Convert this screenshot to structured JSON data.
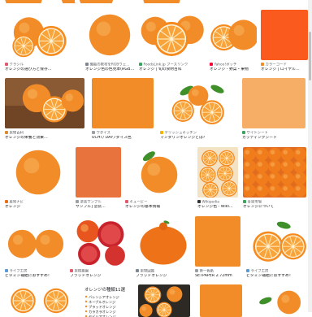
{
  "accent": {
    "orange": "#f28c28",
    "deep_orange": "#fb5a1e",
    "pale_orange": "#f6ad66"
  },
  "scrollbar": {
    "position": 0.12
  },
  "rows": [
    {
      "results": [
        {
          "art": "orange-slice-edge",
          "source": "",
          "favicon_color": "",
          "caption": ""
        },
        {
          "art": "orange-slice-edge",
          "source": "",
          "favicon_color": "",
          "caption": ""
        },
        {
          "art": "orange-slice-edge",
          "source": "",
          "favicon_color": "",
          "caption": ""
        },
        {
          "art": "orange-slice-edge",
          "source": "",
          "favicon_color": "",
          "caption": ""
        },
        {
          "art": "orange-slice-edge",
          "source": "",
          "favicon_color": "",
          "caption": ""
        }
      ]
    },
    {
      "results": [
        {
          "art": "orange-halves-white",
          "source": "クラシル",
          "favicon_color": "#e05a6d",
          "caption": "オレンジの選び方と保存…"
        },
        {
          "art": "orange-whole-single",
          "source": "機能の教材をRGBウェ…",
          "favicon_color": "#7b8794",
          "caption": "オレンジ色の色見本(RGB…"
        },
        {
          "art": "orange-group-slice",
          "source": "FoodsLink.jp フーズリンク",
          "favicon_color": "#3aa55d",
          "caption": "オレンジ | 旬の食材百科"
        },
        {
          "art": "orange-two-halves",
          "source": "Yahoo!ポッチ",
          "favicon_color": "#ff0033",
          "caption": "オレンジ - 野菜・果物"
        },
        {
          "art": "solid-deep-orange",
          "source": "カラーコード",
          "favicon_color": "#f28c28",
          "caption": "オレンジ | ロイヤル…"
        }
      ]
    },
    {
      "results": [
        {
          "art": "orange-on-wood",
          "source": "果物百科",
          "favicon_color": "#d88c2f",
          "caption": "オレンジの栄養と効果…"
        },
        {
          "art": "solid-orange",
          "source": "ワダイス",
          "favicon_color": "#9aa0a6",
          "caption": "UCHI / DAIワダイス色"
        },
        {
          "art": "orange-leaves",
          "source": "デリッシュキッチン",
          "favicon_color": "#f5b300",
          "caption": "マンダリンオレンジとは？"
        },
        {
          "art": "solid-orange-pale",
          "source": "サイトシート",
          "favicon_color": "#3aa55d",
          "caption": "カッティングシート"
        }
      ]
    },
    {
      "results": [
        {
          "art": "orange-whole-big",
          "source": "産地ナビ",
          "favicon_color": "#e7711b",
          "caption": "オレンジ"
        },
        {
          "art": "solid-orange-muted",
          "source": "塗装サンプル",
          "favicon_color": "#9aa0a6",
          "caption": "サンプル] 塗装…"
        },
        {
          "art": "orange-leaf-single",
          "source": "キューピー",
          "favicon_color": "#e05a6d",
          "caption": "オレンジの基本情報"
        },
        {
          "art": "orange-slices-grid",
          "source": "Wikipedia",
          "favicon_color": "#333333",
          "caption": "オレンジ色 - Wiki…"
        },
        {
          "art": "oranges-crate",
          "source": "青果市場",
          "favicon_color": "#3aa55d",
          "caption": "オレンジについて"
        }
      ]
    },
    {
      "results": [
        {
          "art": "orange-pair",
          "source": "ライフ工房",
          "favicon_color": "#5a9bd4",
          "caption": "ビタミン補給におすすめ！"
        },
        {
          "art": "blood-orange",
          "source": "果樹農園",
          "favicon_color": "#e05a6d",
          "caption": "ブラッドオレンジ"
        },
        {
          "art": "orange-dekopon",
          "source": "果物図鑑",
          "favicon_color": "#7b8794",
          "caption": "ブラッドオレンジ"
        },
        {
          "art": "solid-orange",
          "source": "第一色紙",
          "favicon_color": "#9aa0a6",
          "caption": "SETPAPER 2.72mm"
        },
        {
          "art": "orange-slices-leaf",
          "source": "ライフ工房",
          "favicon_color": "#5a9bd4",
          "caption": "ビタミン補給におすすめ！"
        }
      ]
    },
    {
      "results": [
        {
          "art": "orange-slices-row",
          "source": "",
          "favicon_color": "",
          "caption": ""
        },
        {
          "art": "orange-variety-list",
          "source": "",
          "favicon_color": "",
          "caption": "",
          "list_title": "オレンジの種類11選",
          "list_items": [
            "バレンシアオレンジ",
            "ネーブルオレンジ",
            "ブラッドオレンジ",
            "カラカラオレンジ",
            "セビリアオレンジ"
          ]
        },
        {
          "art": "orange-mixed-sliced",
          "source": "",
          "favicon_color": "",
          "caption": ""
        },
        {
          "art": "solid-orange",
          "source": "",
          "favicon_color": "",
          "caption": ""
        },
        {
          "art": "orange-peel-green",
          "source": "",
          "favicon_color": "",
          "caption": ""
        }
      ]
    }
  ]
}
